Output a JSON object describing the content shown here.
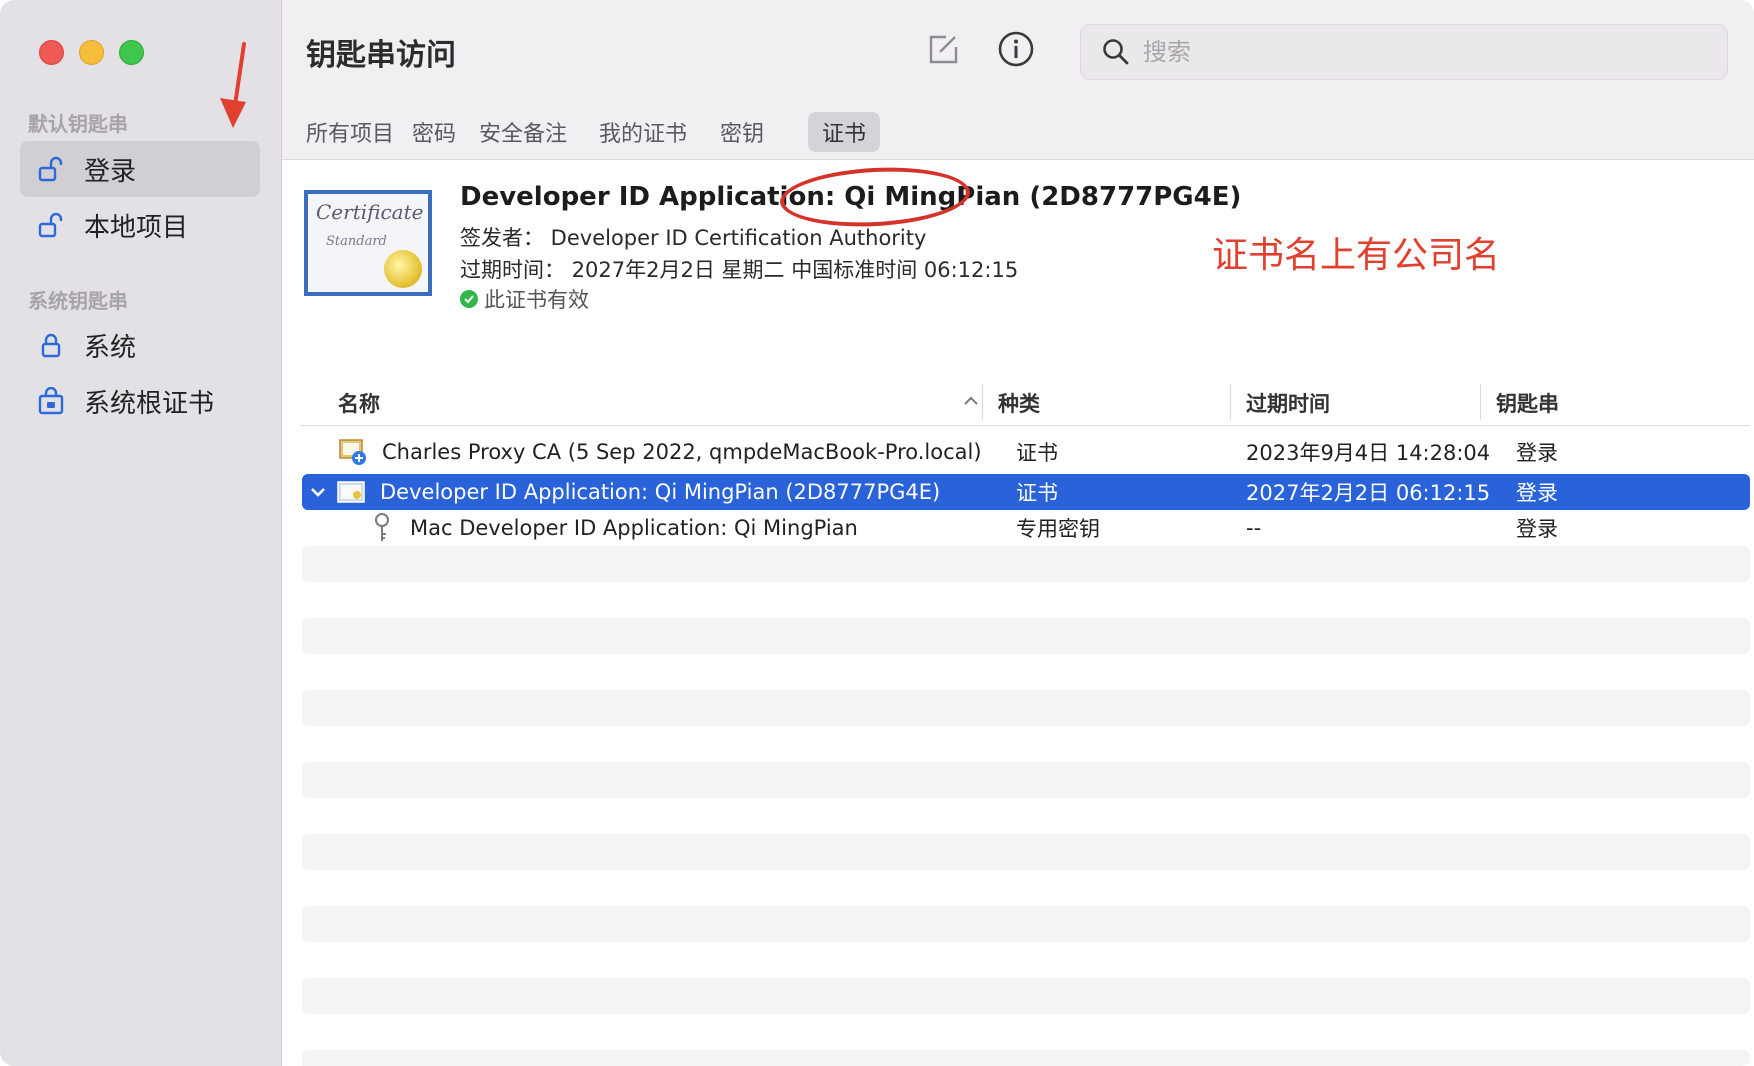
{
  "window": {
    "title": "钥匙串访问"
  },
  "sidebar": {
    "default_section": "默认钥匙串",
    "system_section": "系统钥匙串",
    "items": [
      {
        "label": "登录",
        "icon": "unlocked-padlock-icon",
        "selected": true
      },
      {
        "label": "本地项目",
        "icon": "unlocked-padlock-icon",
        "selected": false
      },
      {
        "label": "系统",
        "icon": "locked-padlock-icon",
        "selected": false
      },
      {
        "label": "系统根证书",
        "icon": "locked-cabinet-icon",
        "selected": false
      }
    ]
  },
  "toolbar": {
    "compose_icon": "compose-icon",
    "info_icon": "info-icon",
    "search_placeholder": "搜索"
  },
  "tabs": [
    {
      "label": "所有项目"
    },
    {
      "label": "密码"
    },
    {
      "label": "安全备注"
    },
    {
      "label": "我的证书"
    },
    {
      "label": "密钥"
    },
    {
      "label": "证书",
      "active": true
    }
  ],
  "detail": {
    "title": "Developer ID Application: Qi MingPian (2D8777PG4E)",
    "issuer": "签发者： Developer ID Certification Authority",
    "expires": "过期时间： 2027年2月2日 星期二 中国标准时间 06:12:15",
    "status": "此证书有效",
    "cert_image_title": "Certificate",
    "cert_image_subtitle": "Standard"
  },
  "annotation": {
    "text": "证书名上有公司名",
    "color": "#e2402f"
  },
  "table": {
    "columns": [
      "名称",
      "种类",
      "过期时间",
      "钥匙串"
    ],
    "rows": [
      {
        "name": "Charles Proxy CA (5 Sep 2022, qmpdeMacBook-Pro.local)",
        "kind": "证书",
        "expires": "2023年9月4日 14:28:04",
        "keychain": "登录",
        "icon": "certificate-plus-icon"
      },
      {
        "name": "Developer ID Application: Qi MingPian (2D8777PG4E)",
        "kind": "证书",
        "expires": "2027年2月2日 06:12:15",
        "keychain": "登录",
        "icon": "certificate-icon",
        "selected": true
      },
      {
        "name": "Mac Developer ID Application: Qi MingPian",
        "kind": "专用密钥",
        "expires": "--",
        "keychain": "登录",
        "icon": "key-icon"
      }
    ]
  },
  "colors": {
    "selection": "#2a62d9",
    "sidebar_bg": "#e4e1e6",
    "valid_green": "#31b64a"
  }
}
